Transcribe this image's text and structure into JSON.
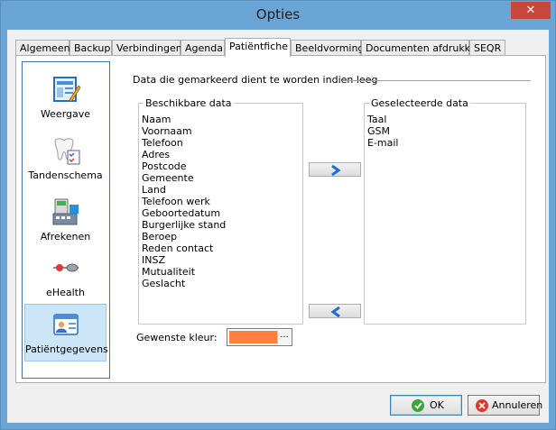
{
  "window": {
    "title": "Opties"
  },
  "tabs": [
    {
      "label": "Algemeen",
      "active": false
    },
    {
      "label": "Backup",
      "active": false
    },
    {
      "label": "Verbindingen",
      "active": false
    },
    {
      "label": "Agenda",
      "active": false
    },
    {
      "label": "Patiëntfiche",
      "active": true
    },
    {
      "label": "Beeldvorming",
      "active": false
    },
    {
      "label": "Documenten afdrukken",
      "active": false
    },
    {
      "label": "SEQR",
      "active": false
    }
  ],
  "sidebar": {
    "items": [
      {
        "label": "Weergave",
        "icon": "layout-pencil-icon",
        "selected": false
      },
      {
        "label": "Tandenschema",
        "icon": "tooth-icon",
        "selected": false
      },
      {
        "label": "Afrekenen",
        "icon": "cash-register-icon",
        "selected": false
      },
      {
        "label": "eHealth",
        "icon": "ehealth-connector-icon",
        "selected": false
      },
      {
        "label": "Patiëntgegevens",
        "icon": "patient-card-icon",
        "selected": true
      }
    ]
  },
  "main": {
    "section_title": "Data die gemarkeerd dient te worden indien leeg",
    "available": {
      "label": "Beschikbare data",
      "items": [
        "Naam",
        "Voornaam",
        "Telefoon",
        "Adres",
        "Postcode",
        "Gemeente",
        "Land",
        "Telefoon werk",
        "Geboortedatum",
        "Burgerlijke stand",
        "Beroep",
        "Reden contact",
        "INSZ",
        "Mutualiteit",
        "Geslacht"
      ]
    },
    "selected": {
      "label": "Geselecteerde data",
      "items": [
        "Taal",
        "GSM",
        "E-mail"
      ]
    },
    "add_button": "arrow-right-icon",
    "remove_button": "arrow-left-icon",
    "color": {
      "label": "Gewenste kleur:",
      "value": "#ff7f3f",
      "browse": "..."
    }
  },
  "footer": {
    "ok_label": "OK",
    "cancel_label": "Annuleren"
  },
  "colors": {
    "titlebar": "#6aa5d6",
    "close": "#c9463d",
    "selected_nav": "#cde6f7",
    "arrow": "#1f6fd1",
    "ok_icon": "#3aa53a",
    "cancel_icon": "#d93a2b"
  }
}
